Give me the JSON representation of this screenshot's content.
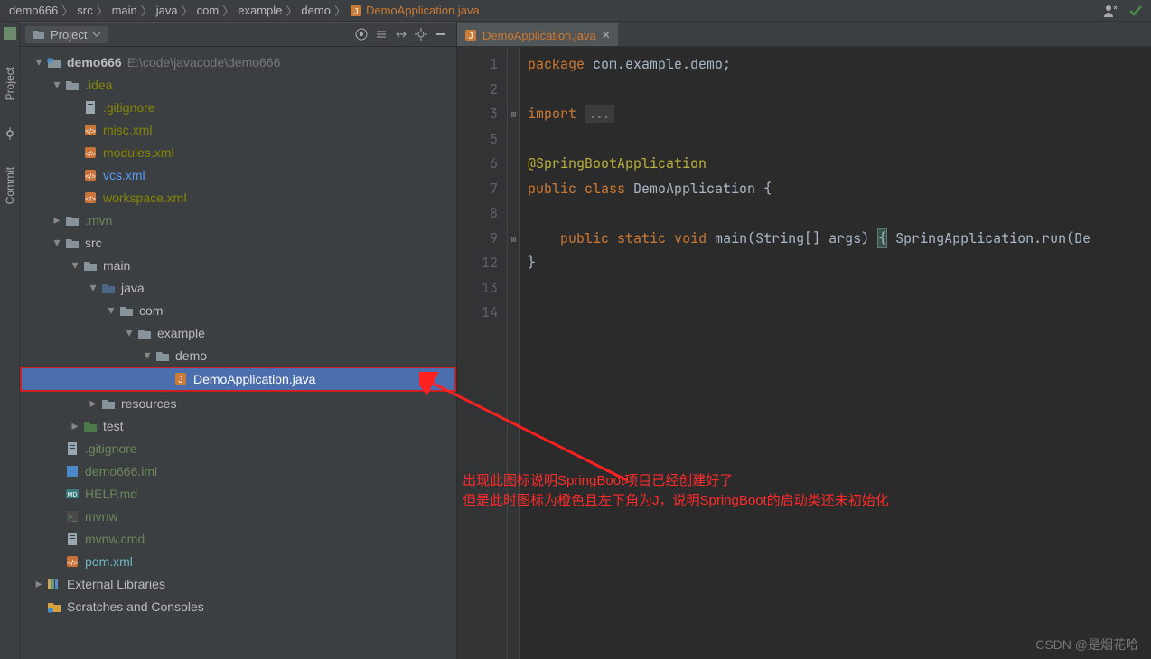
{
  "breadcrumb": {
    "items": [
      "demo666",
      "src",
      "main",
      "java",
      "com",
      "example",
      "demo",
      "DemoApplication.java"
    ]
  },
  "project_panel": {
    "title": "Project"
  },
  "tree": {
    "root": {
      "label": "demo666",
      "path": "E:\\code\\javacode\\demo666"
    },
    "idea": {
      "label": ".idea"
    },
    "idea_children": [
      {
        "label": ".gitignore",
        "color": "ignored",
        "icon": "text"
      },
      {
        "label": "misc.xml",
        "color": "ignored",
        "icon": "xml"
      },
      {
        "label": "modules.xml",
        "color": "ignored",
        "icon": "xml"
      },
      {
        "label": "vcs.xml",
        "color": "blue",
        "icon": "xml"
      },
      {
        "label": "workspace.xml",
        "color": "ignored",
        "icon": "xml"
      }
    ],
    "mvn": {
      "label": ".mvn"
    },
    "src": {
      "label": "src"
    },
    "main": {
      "label": "main"
    },
    "java": {
      "label": "java"
    },
    "com": {
      "label": "com"
    },
    "example": {
      "label": "example"
    },
    "demo": {
      "label": "demo"
    },
    "demo_app": {
      "label": "DemoApplication.java"
    },
    "resources": {
      "label": "resources"
    },
    "test": {
      "label": "test"
    },
    "root_files": [
      {
        "label": ".gitignore",
        "color": "green",
        "icon": "text"
      },
      {
        "label": "demo666.iml",
        "color": "green",
        "icon": "iml"
      },
      {
        "label": "HELP.md",
        "color": "green",
        "icon": "md"
      },
      {
        "label": "mvnw",
        "color": "green",
        "icon": "sh"
      },
      {
        "label": "mvnw.cmd",
        "color": "green",
        "icon": "text"
      },
      {
        "label": "pom.xml",
        "color": "cyan",
        "icon": "xml"
      }
    ],
    "ext_libs": {
      "label": "External Libraries"
    },
    "scratches": {
      "label": "Scratches and Consoles"
    }
  },
  "tabs": [
    {
      "label": "DemoApplication.java"
    }
  ],
  "code": {
    "line_numbers": [
      "1",
      "2",
      "3",
      "5",
      "6",
      "7",
      "8",
      "9",
      "12",
      "13",
      "14"
    ],
    "l1_pkg": "package",
    "l1_rest": " com.example.demo;",
    "l3_imp": "import",
    "l3_fold": "...",
    "l6_ann": "@SpringBootApplication",
    "l7_pub": "public",
    "l7_cls": "class",
    "l7_name": " DemoApplication ",
    "l7_br": "{",
    "l9_pub": "public",
    "l9_stat": "static",
    "l9_void": "void",
    "l9_main": " main(String[] args) ",
    "l9_br": "{",
    "l9_rest": " SpringApplication.run(De",
    "l13": "}"
  },
  "annotation": {
    "line1": "出现此图标说明SpringBoot项目已经创建好了",
    "line2": "但是此时图标为橙色且左下角为J，说明SpringBoot的启动类还未初始化"
  },
  "watermark": "CSDN @是烟花哈"
}
